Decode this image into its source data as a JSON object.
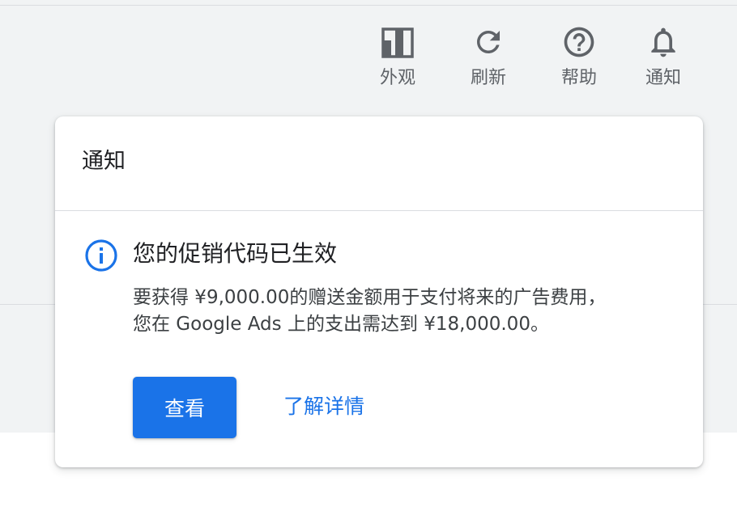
{
  "toolbar": {
    "items": [
      {
        "label": "外观",
        "icon": "appearance-icon"
      },
      {
        "label": "刷新",
        "icon": "refresh-icon"
      },
      {
        "label": "帮助",
        "icon": "help-icon"
      },
      {
        "label": "通知",
        "icon": "bell-icon"
      }
    ]
  },
  "panel": {
    "title": "通知",
    "notice": {
      "icon": "info-icon",
      "title": "您的促销代码已生效",
      "body": "要获得 ¥9,000.00的赠送金额用于支付将来的广告费用，您在 Google Ads 上的支出需达到 ¥18,000.00。",
      "primary_button": "查看",
      "link": "了解详情"
    }
  },
  "colors": {
    "accent": "#1a73e8",
    "header_bg": "#f1f3f4",
    "icon_gray": "#5f6368",
    "text_dark": "#202124"
  }
}
